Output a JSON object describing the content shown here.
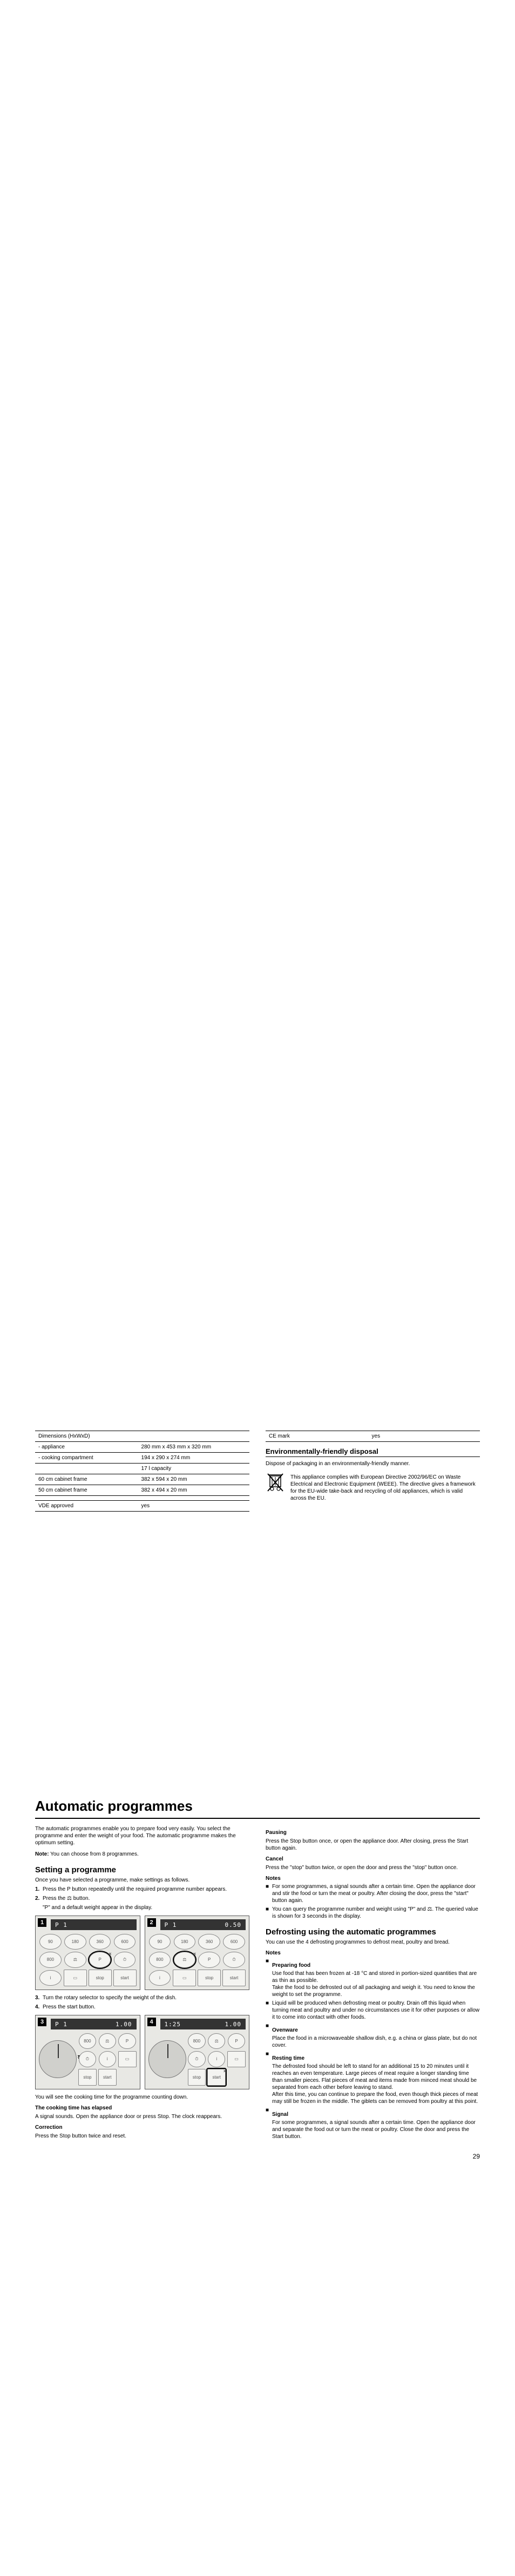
{
  "page_number": "29",
  "spec_table": {
    "rows": [
      {
        "label": "Dimensions (HxWxD)",
        "value": ""
      },
      {
        "label": "- appliance",
        "value": "280 mm x 453 mm x 320 mm"
      },
      {
        "label": "- cooking compartment",
        "value": "194 x 290 x 274 mm"
      },
      {
        "label": "",
        "value": "17 l capacity"
      },
      {
        "label": "60 cm cabinet frame",
        "value": "382 x 594 x 20 mm"
      },
      {
        "label": "50 cm cabinet frame",
        "value": "382 x 494 x 20 mm"
      },
      {
        "label": "",
        "value": ""
      },
      {
        "label": "VDE approved",
        "value": "yes"
      }
    ]
  },
  "ce_row": {
    "label": "CE mark",
    "value": "yes"
  },
  "env_title": "Environmentally-friendly disposal",
  "env_intro": "Dispose of packaging in an environmentally-friendly manner.",
  "env_body": "This appliance complies with European Directive 2002/96/EC on Waste Electrical and Electronic Equipment (WEEE). The directive gives a framework for the EU-wide take-back and recycling of old appliances, which is valid across the EU.",
  "main_heading": "Automatic programmes",
  "main_intro": "The automatic programmes enable you to prepare food very easily. You select the programme and enter the weight of your food. The automatic programme makes the optimum setting.",
  "main_note_label": "Note:",
  "main_note": " You can choose from 8 programmes.",
  "setting_title": "Setting a programme",
  "setting_intro": "Once you have selected a programme, make settings as follows.",
  "steps": [
    {
      "n": "1.",
      "t": "Press the P button repeatedly until the required programme number appears."
    },
    {
      "n": "2.",
      "t": "Press the ⚖ button."
    },
    {
      "n": "",
      "t": "\"P\" and a default weight appear in the display."
    },
    {
      "n": "3.",
      "t": "Turn the rotary selector to specify the weight of the dish."
    },
    {
      "n": "4.",
      "t": "Press the start button."
    }
  ],
  "panel_display": {
    "p1": "P   1",
    "p1r": "",
    "p2": "P   1",
    "p2r": "0.50",
    "p3": "P   1",
    "p3r": "1.00",
    "p4": "1:25",
    "p4r": "1.00"
  },
  "btn_labels": {
    "b90": "90",
    "b180": "180",
    "b360": "360",
    "b600": "600",
    "b800": "800",
    "weight": "⚖",
    "prog": "P",
    "clock": "⏱",
    "i": "i",
    "stop": "stop",
    "start": "start"
  },
  "after_panels": "You will see the cooking time for the programme counting down.",
  "elapsed_title": "The cooking time has elapsed",
  "elapsed_body": "A signal sounds. Open the appliance door or press Stop. The clock reappears.",
  "correction_title": "Correction",
  "correction_body": "Press the Stop button twice and reset.",
  "pausing_title": "Pausing",
  "pausing_body1": "Press the Stop button once, or open the appliance door. After closing, press the Start button again.",
  "cancel_title": "Cancel",
  "cancel_body": "Press the \"stop\" button twice, or open the door and press the \"stop\" button once.",
  "notes_title": "Notes",
  "notes": [
    "For some programmes, a signal sounds after a certain time. Open the appliance door and stir the food or turn the meat or poultry. After closing the door, press the \"start\" button again.",
    "You can query the programme number and weight using \"P\" and ⚖. The queried value is shown for 3 seconds in the display."
  ],
  "defrost_title": "Defrosting using the automatic programmes",
  "defrost_intro": "You can use the 4 defrosting programmes to defrost meat, poultry and bread.",
  "defrost_notes_title": "Notes",
  "defrost_items": [
    {
      "t": "Preparing food",
      "b": "Use food that has been frozen at -18 °C and stored in portion-sized quantities that are as thin as possible.\nTake the food to be defrosted out of all packaging and weigh it. You need to know the weight to set the programme."
    },
    {
      "t": "",
      "b": "Liquid will be produced when defrosting meat or poultry. Drain off this liquid when turning meat and poultry and under no circumstances use it for other purposes or allow it to come into contact with other foods."
    },
    {
      "t": "Ovenware",
      "b": "Place the food in a microwaveable shallow dish, e.g. a china or glass plate, but do not cover."
    },
    {
      "t": "Resting time",
      "b": "The defrosted food should be left to stand for an additional 15 to 20 minutes until it reaches an even temperature. Large pieces of meat require a longer standing time than smaller pieces. Flat pieces of meat and items made from minced meat should be separated from each other before leaving to stand.\nAfter this time, you can continue to prepare the food, even though thick pieces of meat may still be frozen in the middle. The giblets can be removed from poultry at this point."
    },
    {
      "t": "Signal",
      "b": "For some programmes, a signal sounds after a certain time. Open the appliance door and separate the food out or turn the meat or poultry. Close the door and press the Start button."
    }
  ]
}
